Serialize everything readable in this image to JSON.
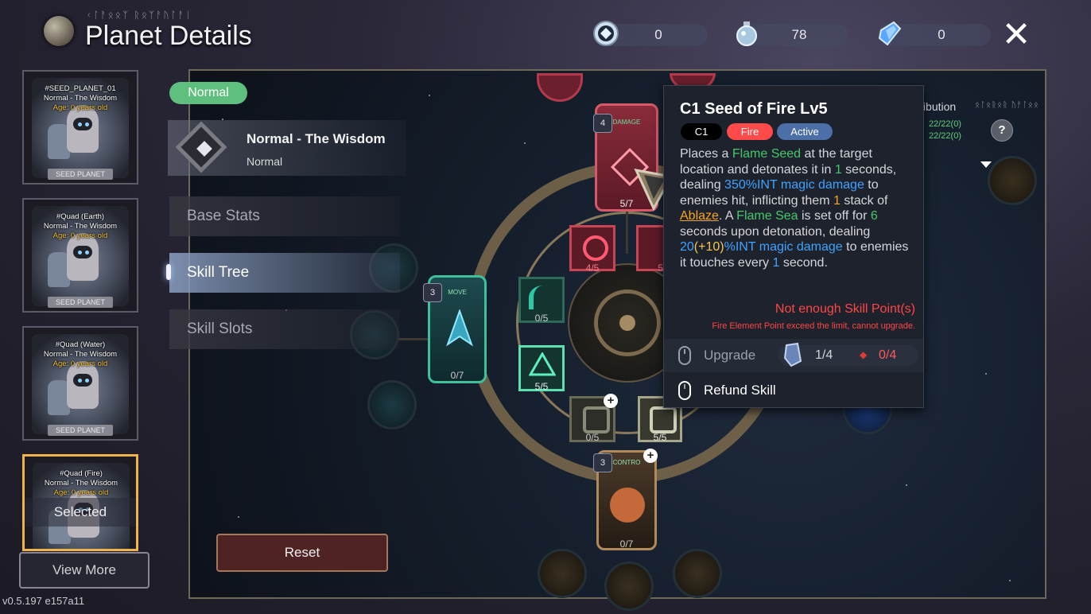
{
  "header": {
    "title": "Planet Details",
    "runes": "ᚲᛚᚨᛟᛟᛉ ᚱᛟᛉᚨᚢᛚᚨᛁ",
    "currencies": [
      {
        "icon": "crystal-coin-icon",
        "value": "0"
      },
      {
        "icon": "potion-icon",
        "value": "78"
      },
      {
        "icon": "blue-gem-icon",
        "value": "0"
      }
    ],
    "close_label": "✕"
  },
  "planet_list": [
    {
      "id": "#SEED_PLANET_01",
      "name": "Normal - The Wisdom",
      "age": "Age: 0 years old",
      "badge": "SEED PLANET"
    },
    {
      "id": "#Quad (Earth)",
      "name": "Normal - The Wisdom",
      "age": "Age: 0 years old",
      "badge": "SEED PLANET"
    },
    {
      "id": "#Quad (Water)",
      "name": "Normal - The Wisdom",
      "age": "Age: 0 years old",
      "badge": "SEED PLANET"
    },
    {
      "id": "#Quad (Fire)",
      "name": "Normal - The Wisdom",
      "age": "Age: 0 years old",
      "selected_label": "Selected"
    }
  ],
  "view_more": "View More",
  "version": "v0.5.197 e157a11",
  "planet": {
    "difficulty": "Normal",
    "title": "Normal - The Wisdom",
    "subtitle": "Normal"
  },
  "menu": [
    {
      "label": "Base Stats",
      "active": false
    },
    {
      "label": "Skill Tree",
      "active": true
    },
    {
      "label": "Skill Slots",
      "active": false
    }
  ],
  "reset_label": "Reset",
  "tree": {
    "damage_label": "DAMAGE",
    "damage_level": "4",
    "damage_count": "5/7",
    "move_label": "MOVE",
    "move_level": "3",
    "move_count": "0/7",
    "control_label": "CONTRO",
    "control_level": "3",
    "control_count": "0/7",
    "n1": "4/5",
    "n2": "5",
    "n3": "0/5",
    "n4": "5/5",
    "n5": "0/5",
    "n6": "5/5"
  },
  "tooltip": {
    "title": "C1 Seed of Fire Lv5",
    "tags": [
      "C1",
      "Fire",
      "Active"
    ],
    "desc": {
      "p1": "Places a ",
      "flame_seed": "Flame Seed",
      "p2": " at the target location and detonates it in ",
      "sec1": "1",
      "p3": " seconds, dealing ",
      "dmg1": "350%INT magic damage",
      "p4": " to enemies hit, inflicting them ",
      "stack": "1",
      "p5": " stack of ",
      "ablaze": "Ablaze",
      "p6": ". A ",
      "flame_sea": "Flame Sea",
      "p7": " is set off for ",
      "sec2": "6",
      "p8": " seconds upon detonation, dealing ",
      "dmg2a": "20",
      "dmg2b": "(+10)",
      "dmg2c": "%INT magic damage",
      "p9": " to enemies it touches every ",
      "sec3": "1",
      "p10": " second."
    },
    "error": "Not enough Skill Point(s)",
    "error_sub": "Fire Element Point exceed the limit, cannot upgrade.",
    "upgrade_label": "Upgrade",
    "upgrade_cost_a": "1/4",
    "upgrade_cost_b": "0/4",
    "refund_label": "Refund Skill"
  },
  "elemental": {
    "label": "Elemental Distribution",
    "runes": "ᛟᛚᛟᚱᛟᚱ ᚢᚨᛚᛟᛟ",
    "rows": [
      "22/22(0)",
      "22/22(0)"
    ],
    "help": "?"
  },
  "colors": {
    "accent_green": "#5fbf7f",
    "fire_red": "#ff4a4a",
    "active_blue": "#4c6fa8",
    "select_gold": "#f0b24a"
  }
}
